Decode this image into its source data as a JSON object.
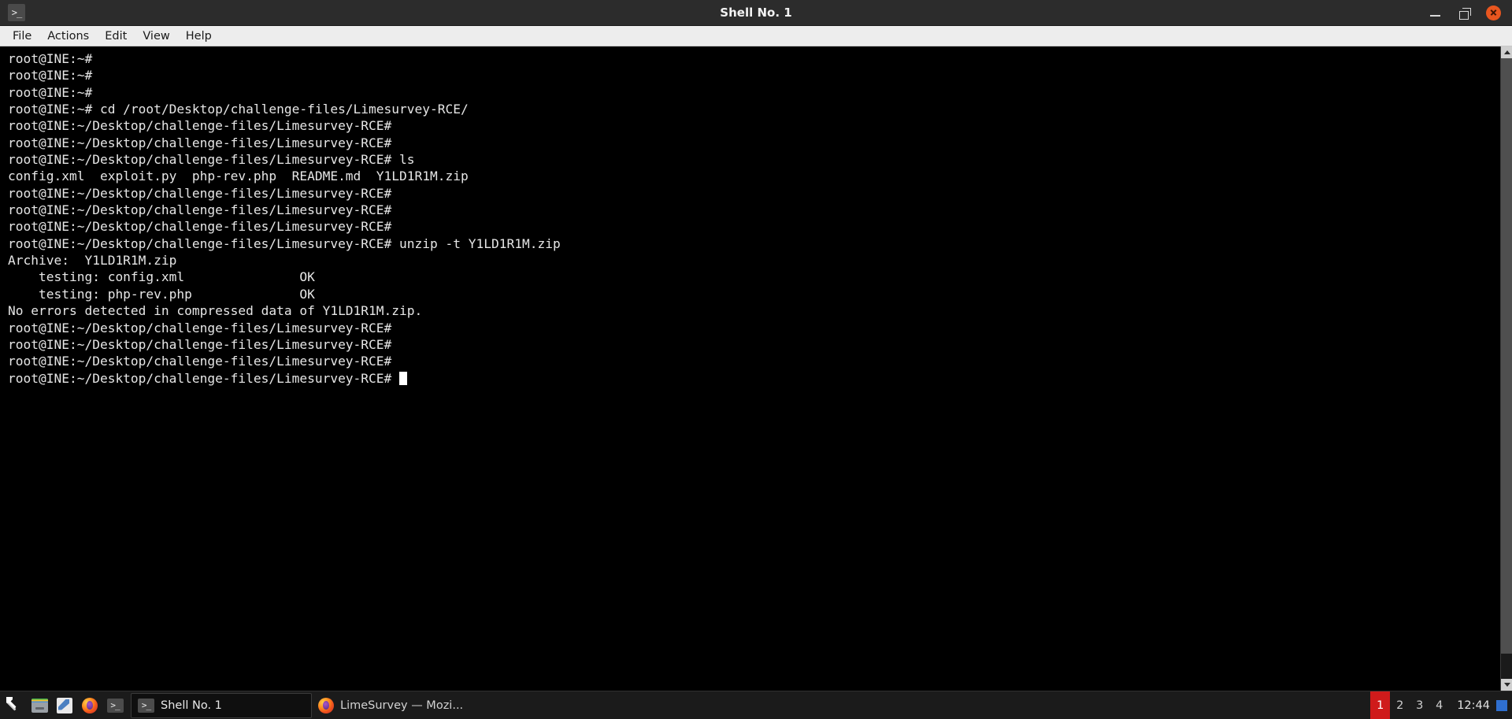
{
  "window": {
    "title": "Shell No. 1",
    "app_icon": "terminal-icon",
    "controls": {
      "minimize": "minimize-icon",
      "maximize": "maximize-icon",
      "close": "close-icon",
      "close_color": "#e9561f"
    }
  },
  "menubar": {
    "items": [
      {
        "label": "File"
      },
      {
        "label": "Actions"
      },
      {
        "label": "Edit"
      },
      {
        "label": "View"
      },
      {
        "label": "Help"
      }
    ]
  },
  "terminal": {
    "background": "#000000",
    "foreground": "#e6e6e6",
    "cursor_visible": true,
    "lines": [
      "root@INE:~#",
      "root@INE:~#",
      "root@INE:~#",
      "root@INE:~# cd /root/Desktop/challenge-files/Limesurvey-RCE/",
      "root@INE:~/Desktop/challenge-files/Limesurvey-RCE#",
      "root@INE:~/Desktop/challenge-files/Limesurvey-RCE#",
      "root@INE:~/Desktop/challenge-files/Limesurvey-RCE# ls",
      "config.xml  exploit.py  php-rev.php  README.md  Y1LD1R1M.zip",
      "root@INE:~/Desktop/challenge-files/Limesurvey-RCE#",
      "root@INE:~/Desktop/challenge-files/Limesurvey-RCE#",
      "root@INE:~/Desktop/challenge-files/Limesurvey-RCE#",
      "root@INE:~/Desktop/challenge-files/Limesurvey-RCE# unzip -t Y1LD1R1M.zip",
      "Archive:  Y1LD1R1M.zip",
      "    testing: config.xml               OK",
      "    testing: php-rev.php              OK",
      "No errors detected in compressed data of Y1LD1R1M.zip.",
      "root@INE:~/Desktop/challenge-files/Limesurvey-RCE#",
      "root@INE:~/Desktop/challenge-files/Limesurvey-RCE#",
      "root@INE:~/Desktop/challenge-files/Limesurvey-RCE#"
    ],
    "prompt_line": "root@INE:~/Desktop/challenge-files/Limesurvey-RCE# "
  },
  "taskbar": {
    "launchers": [
      {
        "name": "tools-wrench",
        "icon": "wrench-icon"
      },
      {
        "name": "file-manager",
        "icon": "file-manager-icon"
      },
      {
        "name": "text-editor",
        "icon": "text-editor-icon"
      },
      {
        "name": "firefox",
        "icon": "firefox-icon"
      },
      {
        "name": "terminal",
        "icon": "terminal-icon"
      }
    ],
    "tasks": [
      {
        "label": "Shell No. 1",
        "icon": "terminal-icon",
        "active": true
      },
      {
        "label": "LimeSurvey — Mozi...",
        "icon": "firefox-icon",
        "active": false
      }
    ],
    "workspaces": [
      {
        "label": "1",
        "active": true
      },
      {
        "label": "2",
        "active": false
      },
      {
        "label": "3",
        "active": false
      },
      {
        "label": "4",
        "active": false
      }
    ],
    "active_workspace_color": "#cf1b1b",
    "clock": "12:44",
    "indicator": "tray-indicator"
  }
}
